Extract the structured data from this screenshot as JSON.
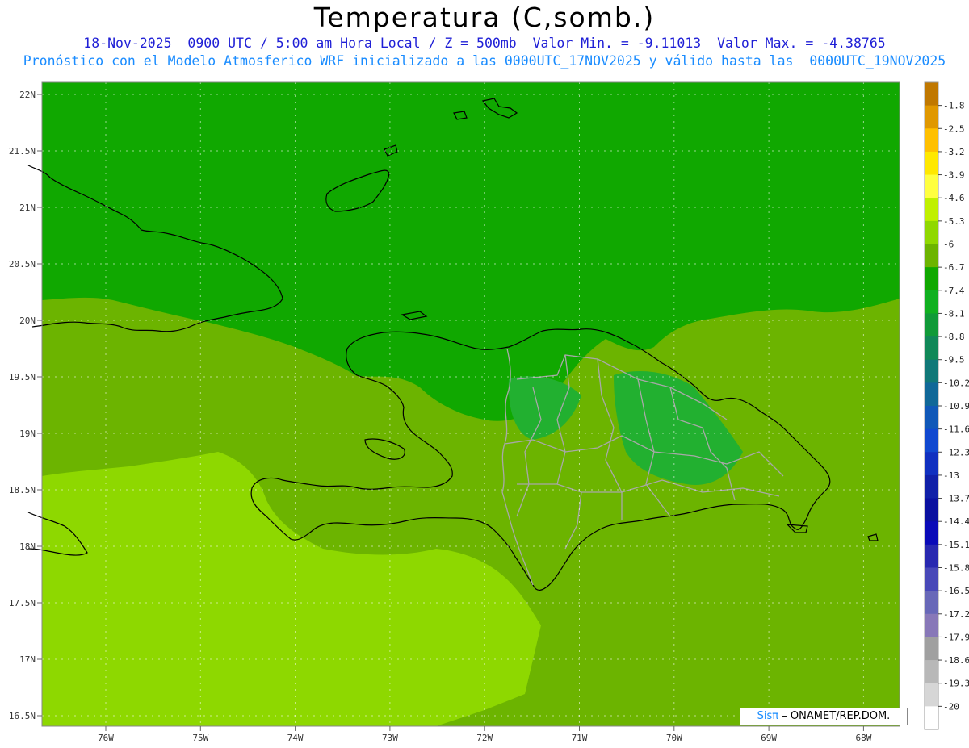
{
  "title": "Temperatura (C,somb.)",
  "subtitle_line1": "18-Nov-2025  0900 UTC / 5:00 am Hora Local / Z = 500mb  Valor Min. = -9.11013  Valor Max. = -4.38765",
  "subtitle_line2": "Pronóstico con el Modelo Atmosferico WRF inicializado a las 0000UTC_17NOV2025 y válido hasta las  0000UTC_19NOV2025",
  "credit": {
    "sis": "Sisπ",
    "org": "– ONAMET/REP.DOM."
  },
  "lat_labels": [
    "22N",
    "21.5N",
    "21N",
    "20.5N",
    "20N",
    "19.5N",
    "19N",
    "18.5N",
    "18N",
    "17.5N",
    "17N",
    "16.5N"
  ],
  "lon_labels": [
    "76W",
    "75W",
    "74W",
    "73W",
    "72W",
    "71W",
    "70W",
    "69W",
    "68W"
  ],
  "colorbar": {
    "labels": [
      "-1.8",
      "-2.5",
      "-3.2",
      "-3.9",
      "-4.6",
      "-5.3",
      "-6",
      "-6.7",
      "-7.4",
      "-8.1",
      "-8.8",
      "-9.5",
      "-10.2",
      "-10.9",
      "-11.6",
      "-12.3",
      "-13",
      "-13.7",
      "-14.4",
      "-15.1",
      "-15.8",
      "-16.5",
      "-17.2",
      "-17.9",
      "-18.6",
      "-19.3",
      "-20"
    ],
    "colors": [
      "#c07800",
      "#e09800",
      "#ffc000",
      "#ffe800",
      "#ffff40",
      "#c0f000",
      "#90d800",
      "#6cb400",
      "#10a800",
      "#10b020",
      "#109a38",
      "#108858",
      "#107878",
      "#106898",
      "#1058b8",
      "#1048d0",
      "#1030c0",
      "#1020a8",
      "#0a10a0",
      "#0a0ab8",
      "#2828b0",
      "#4848b8",
      "#6868b8",
      "#8878b8",
      "#a0a0a0",
      "#b8b8b8",
      "#d6d6d6",
      "#ffffff"
    ]
  },
  "field_colors": {
    "north": "#10a800",
    "mid": "#6cb400",
    "south": "#8ed800",
    "patches": "#22b030"
  }
}
